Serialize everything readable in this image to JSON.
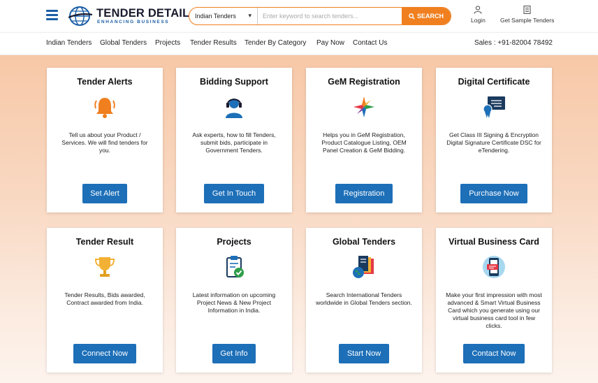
{
  "header": {
    "logo_title": "TENDER DETAIL",
    "logo_subtitle": "ENHANCING BUSINESS",
    "search": {
      "category": "Indian Tenders",
      "placeholder": "Enter keyword to search tenders...",
      "button_label": "SEARCH"
    },
    "login_label": "Login",
    "sample_label": "Get Sample Tenders"
  },
  "nav": {
    "items": [
      "Indian Tenders",
      "Global Tenders",
      "Projects",
      "Tender Results",
      "Tender By Category",
      "Pay Now",
      "Contact Us"
    ],
    "sales": "Sales : +91-82004 78492"
  },
  "cards": [
    {
      "title": "Tender Alerts",
      "icon": "bell-icon",
      "desc": "Tell us about your Product / Services. We will find tenders for you.",
      "button": "Set Alert"
    },
    {
      "title": "Bidding Support",
      "icon": "support-agent-icon",
      "desc": "Ask experts, how to fill Tenders, submit bids, participate in Government Tenders.",
      "button": "Get In Touch"
    },
    {
      "title": "GeM Registration",
      "icon": "gem-logo-icon",
      "desc": "Helps you in GeM Registration, Product Catalogue Listing, OEM Panel Creation & GeM Bidding.",
      "button": "Registration"
    },
    {
      "title": "Digital Certificate",
      "icon": "certificate-icon",
      "desc": "Get Class III Signing & Encryption Digital Signature Certificate DSC for eTendering.",
      "button": "Purchase Now"
    },
    {
      "title": "Tender Result",
      "icon": "trophy-icon",
      "desc": "Tender Results, Bids awarded, Contract awarded from India.",
      "button": "Connect Now"
    },
    {
      "title": "Projects",
      "icon": "clipboard-check-icon",
      "desc": "Latest information on upcoming Project News & New Project Information in India.",
      "button": "Get Info"
    },
    {
      "title": "Global Tenders",
      "icon": "global-documents-icon",
      "desc": "Search International Tenders worldwide in Global Tenders section.",
      "button": "Start Now"
    },
    {
      "title": "Virtual Business Card",
      "icon": "mobile-card-icon",
      "desc": "Make your first impression with most advanced & Smart Virtual Business Card which you generate using our virtual business card tool in few clicks.",
      "button": "Contact Now"
    }
  ],
  "colors": {
    "accent_orange": "#f07f1f",
    "button_blue": "#1d6fb8",
    "brand_blue": "#1b5ea6"
  }
}
